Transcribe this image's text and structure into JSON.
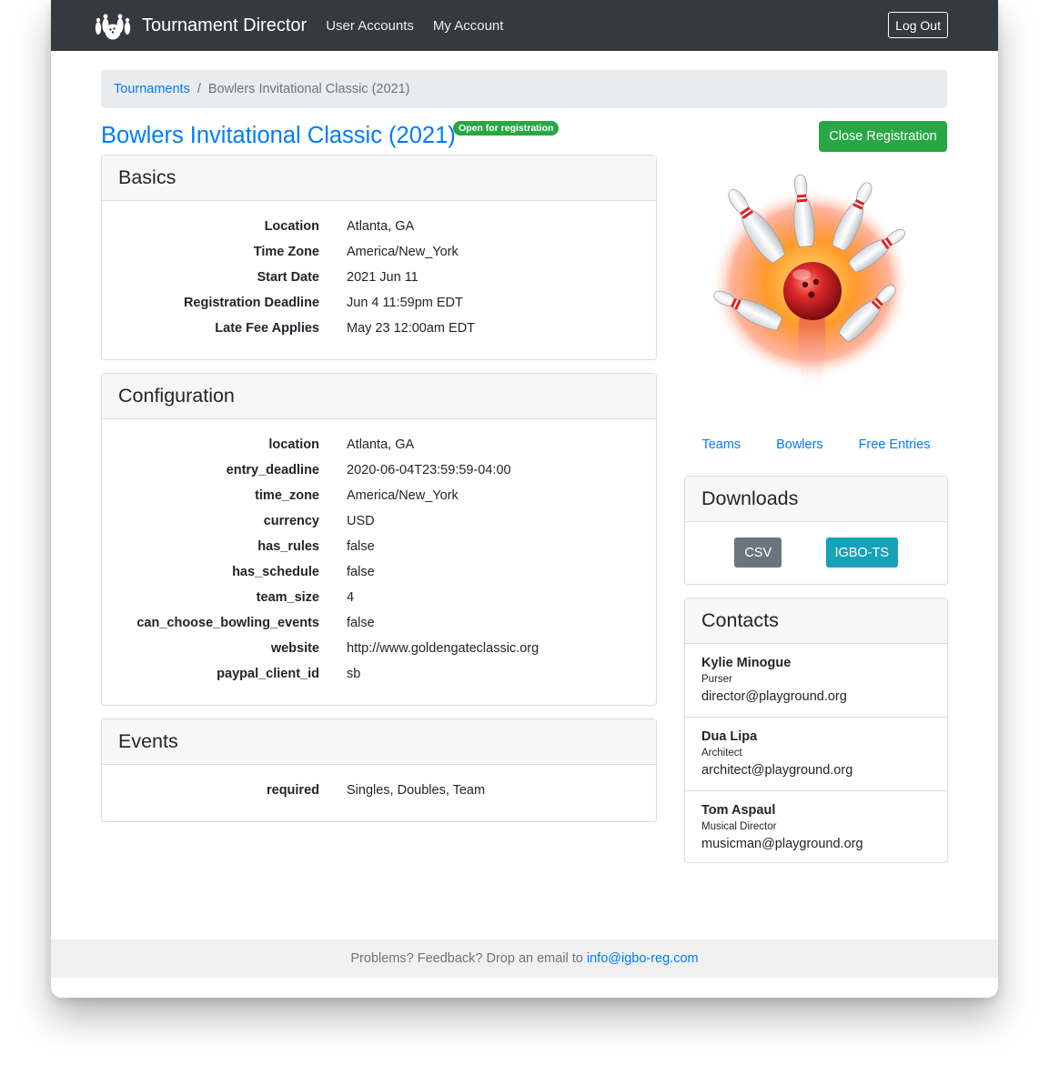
{
  "navbar": {
    "brand": "Tournament Director",
    "links": [
      "User Accounts",
      "My Account"
    ],
    "logout_label": "Log Out"
  },
  "breadcrumb": {
    "root": "Tournaments",
    "current": "Bowlers Invitational Classic (2021)"
  },
  "page": {
    "title": "Bowlers Invitational Classic (2021)",
    "status_badge": "Open for registration",
    "close_registration_label": "Close Registration"
  },
  "basics": {
    "header": "Basics",
    "rows": [
      {
        "key": "Location",
        "value": "Atlanta, GA"
      },
      {
        "key": "Time Zone",
        "value": "America/New_York"
      },
      {
        "key": "Start Date",
        "value": "2021 Jun 11"
      },
      {
        "key": "Registration Deadline",
        "value": "Jun 4 11:59pm EDT"
      },
      {
        "key": "Late Fee Applies",
        "value": "May 23 12:00am EDT"
      }
    ]
  },
  "configuration": {
    "header": "Configuration",
    "rows": [
      {
        "key": "location",
        "value": "Atlanta, GA"
      },
      {
        "key": "entry_deadline",
        "value": "2020-06-04T23:59:59-04:00"
      },
      {
        "key": "time_zone",
        "value": "America/New_York"
      },
      {
        "key": "currency",
        "value": "USD"
      },
      {
        "key": "has_rules",
        "value": "false"
      },
      {
        "key": "has_schedule",
        "value": "false"
      },
      {
        "key": "team_size",
        "value": "4"
      },
      {
        "key": "can_choose_bowling_events",
        "value": "false"
      },
      {
        "key": "website",
        "value": "http://www.goldengateclassic.org"
      },
      {
        "key": "paypal_client_id",
        "value": "sb"
      }
    ]
  },
  "events": {
    "header": "Events",
    "rows": [
      {
        "key": "required",
        "value": "Singles, Doubles, Team"
      }
    ]
  },
  "side_links": [
    "Teams",
    "Bowlers",
    "Free Entries"
  ],
  "downloads": {
    "header": "Downloads",
    "csv_label": "CSV",
    "igbo_label": "IGBO-TS"
  },
  "contacts": {
    "header": "Contacts",
    "items": [
      {
        "name": "Kylie Minogue",
        "role": "Purser",
        "email": "director@playground.org"
      },
      {
        "name": "Dua Lipa",
        "role": "Architect",
        "email": "architect@playground.org"
      },
      {
        "name": "Tom Aspaul",
        "role": "Musical Director",
        "email": "musicman@playground.org"
      }
    ]
  },
  "footer": {
    "text": "Problems? Feedback? Drop an email to",
    "email": "info@igbo-reg.com"
  },
  "colors": {
    "navbar": "#343a40",
    "link": "#007bff",
    "success": "#28a745",
    "secondary": "#6c757d",
    "info": "#17a2b8"
  },
  "icons": {
    "brand_logo": "bowling-pins-icon",
    "hero": "bowling-strike-image"
  }
}
